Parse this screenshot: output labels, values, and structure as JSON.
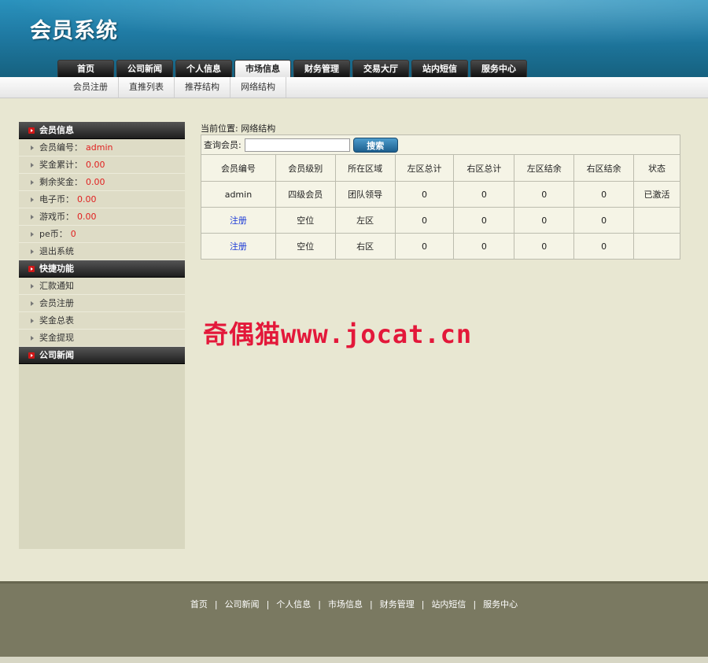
{
  "header": {
    "logo": "会员系统"
  },
  "nav": {
    "tabs": [
      "首页",
      "公司新闻",
      "个人信息",
      "市场信息",
      "财务管理",
      "交易大厅",
      "站内短信",
      "服务中心"
    ],
    "active": "市场信息"
  },
  "subnav": {
    "items": [
      "会员注册",
      "直推列表",
      "推荐结构",
      "网络结构"
    ]
  },
  "sidebar": {
    "section1": {
      "title": "会员信息",
      "items": [
        {
          "label": "会员编号：",
          "value": "admin"
        },
        {
          "label": "奖金累计：",
          "value": "0.00"
        },
        {
          "label": "剩余奖金：",
          "value": "0.00"
        },
        {
          "label": "电子币：",
          "value": "0.00"
        },
        {
          "label": "游戏币：",
          "value": "0.00"
        },
        {
          "label": "pe币：",
          "value": "0"
        },
        {
          "label": "退出系统",
          "value": ""
        }
      ]
    },
    "section2": {
      "title": "快捷功能",
      "items": [
        "汇款通知",
        "会员注册",
        "奖金总表",
        "奖金提现"
      ]
    },
    "section3": {
      "title": "公司新闻"
    }
  },
  "main": {
    "breadcrumb": "当前位置: 网络结构",
    "query_label": "查询会员:",
    "query_value": "",
    "search_button": "搜索",
    "table": {
      "headers": [
        "会员编号",
        "会员级别",
        "所在区域",
        "左区总计",
        "右区总计",
        "左区结余",
        "右区结余",
        "状态"
      ],
      "rows": [
        [
          "admin",
          "四级会员",
          "团队领导",
          "0",
          "0",
          "0",
          "0",
          "已激活"
        ],
        [
          "注册",
          "空位",
          "左区",
          "0",
          "0",
          "0",
          "0",
          ""
        ],
        [
          "注册",
          "空位",
          "右区",
          "0",
          "0",
          "0",
          "0",
          ""
        ]
      ]
    }
  },
  "watermark": "奇偶猫www.jocat.cn",
  "footer": {
    "links": [
      "首页",
      "公司新闻",
      "个人信息",
      "市场信息",
      "财务管理",
      "站内短信",
      "服务中心"
    ]
  }
}
